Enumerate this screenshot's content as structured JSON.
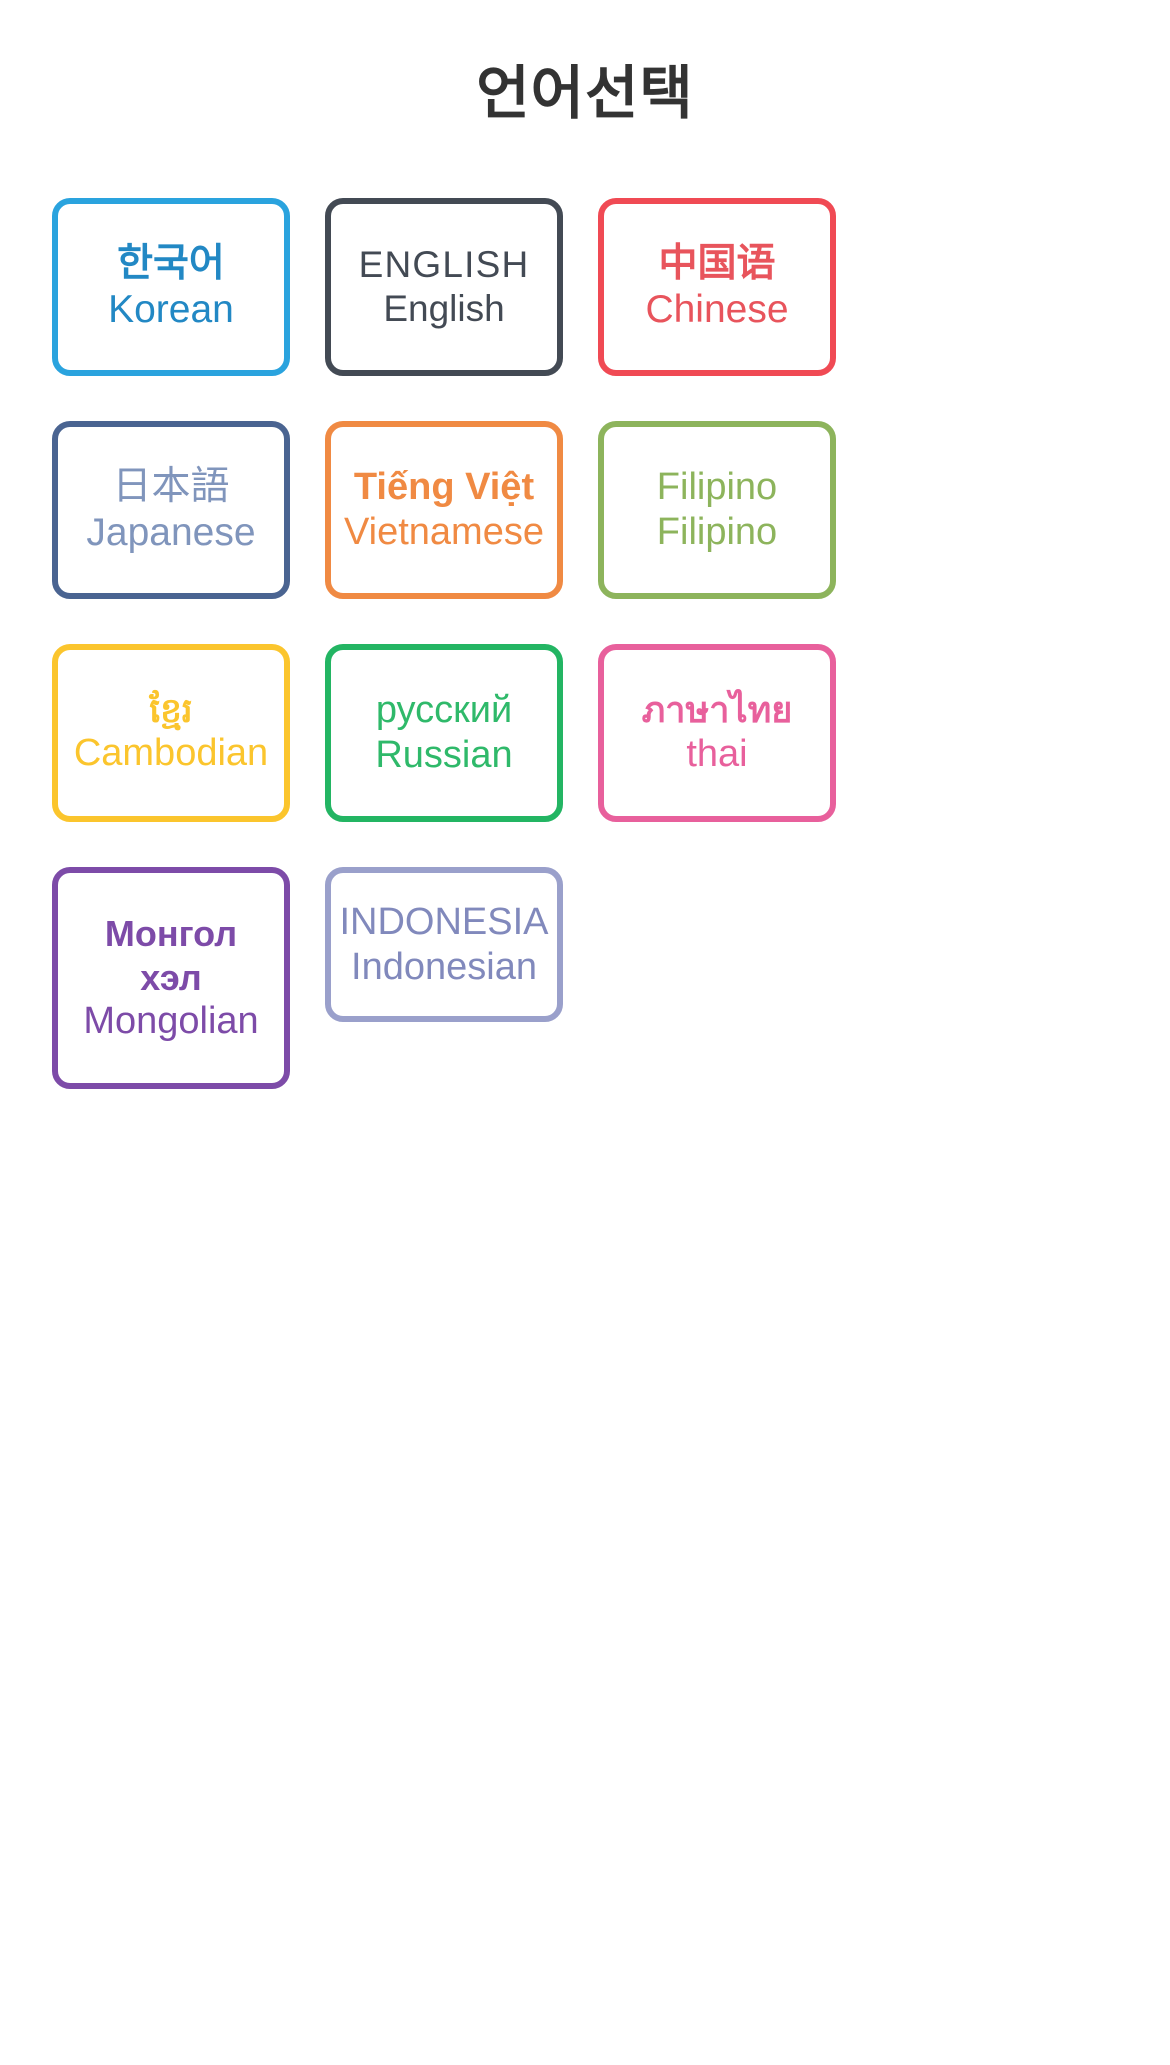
{
  "page": {
    "title": "언어선택",
    "title_color": "#333333",
    "background": "#ffffff"
  },
  "languages": [
    {
      "id": "korean",
      "native": "한국어",
      "english": "Korean",
      "color": "#2AA3DE",
      "border_color": "#2AA3DE",
      "text_color": "#2288c4"
    },
    {
      "id": "english",
      "native": "ENGLISH",
      "english": "English",
      "color": "#434A54",
      "border_color": "#434A54",
      "text_color": "#434A54"
    },
    {
      "id": "chinese",
      "native": "中国语",
      "english": "Chinese",
      "color": "#F04A54",
      "border_color": "#F04A54",
      "text_color": "#E8545C"
    },
    {
      "id": "japanese",
      "native": "日本語",
      "english": "Japanese",
      "color": "#4A6491",
      "border_color": "#4A6491",
      "text_color": "#8095BC"
    },
    {
      "id": "vietnamese",
      "native": "Tiếng Việt",
      "english": "Vietnamese",
      "color": "#F08A43",
      "border_color": "#F08A43",
      "text_color": "#F08A43"
    },
    {
      "id": "filipino",
      "native": "Filipino",
      "english": "Filipino",
      "color": "#8DB45C",
      "border_color": "#8DB45C",
      "text_color": "#8DB45C"
    },
    {
      "id": "cambodian",
      "native": "ខ្មែរ",
      "english": "Cambodian",
      "color": "#FBC52D",
      "border_color": "#FBC52D",
      "text_color": "#FBC52D"
    },
    {
      "id": "russian",
      "native": "русский",
      "english": "Russian",
      "color": "#23B563",
      "border_color": "#23B563",
      "text_color": "#2FB96A"
    },
    {
      "id": "thai",
      "native": "ภาษาไทย",
      "english": "thai",
      "color": "#E8609C",
      "border_color": "#E8609C",
      "text_color": "#E8609C"
    },
    {
      "id": "mongolian",
      "native": "Монгол\nхэл",
      "english": "Mongolian",
      "color": "#7D4BA8",
      "border_color": "#7D4BA8",
      "text_color": "#7D4BA8"
    },
    {
      "id": "indonesian",
      "native": "INDONESIA",
      "english": "Indonesian",
      "color": "#8189BC",
      "border_color": "#9AA0CB",
      "text_color": "#8189BC"
    }
  ]
}
